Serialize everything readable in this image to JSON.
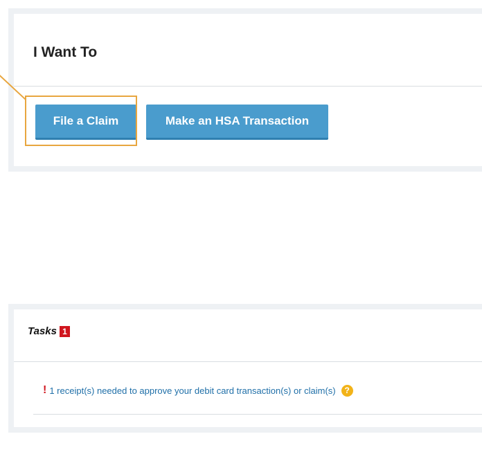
{
  "want_to": {
    "title": "I Want To",
    "buttons": {
      "file_claim": "File a Claim",
      "hsa_transaction": "Make an HSA Transaction"
    }
  },
  "tasks": {
    "title": "Tasks",
    "count": "1",
    "items": [
      {
        "alert": "!",
        "text": "1 receipt(s) needed to approve your debit card transaction(s) or claim(s)",
        "help": "?"
      }
    ]
  },
  "colors": {
    "button": "#4a9ccd",
    "highlight": "#e8a63f",
    "badge": "#d0161e",
    "link": "#1f6fa8",
    "help_icon": "#f2b319"
  }
}
